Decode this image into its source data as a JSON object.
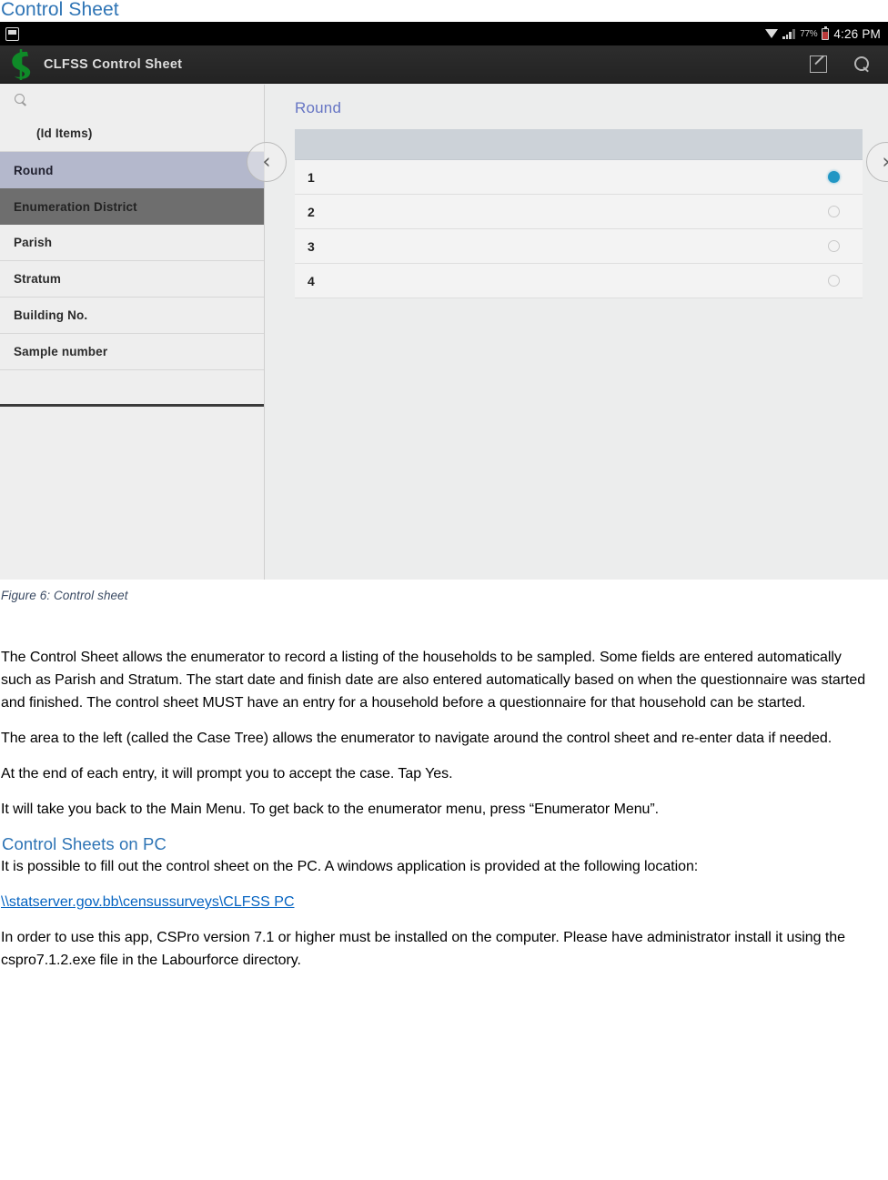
{
  "document": {
    "heading": "Control Sheet",
    "figure_caption": "Figure 6: Control sheet",
    "paragraphs": [
      "The Control Sheet allows the enumerator to record a listing of the households to be sampled. Some fields are entered automatically such as Parish and Stratum. The start date and finish date are also entered automatically based on when the questionnaire was started and finished. The control sheet MUST have an entry for a household before a questionnaire for that household can be started.",
      "The area to the left (called the Case Tree) allows the enumerator to navigate around the control sheet and re-enter data if needed.",
      "At the end of each entry, it will prompt you to accept the case. Tap Yes.",
      "It will take you back to the Main Menu. To get back to the enumerator menu, press “Enumerator Menu”."
    ],
    "subheading": "Control Sheets on PC",
    "pc_intro": "It is possible to fill out the control sheet on the PC. A windows application is provided at the following location:",
    "pc_link": "\\\\statserver.gov.bb\\censussurveys\\CLFSS PC",
    "pc_outro": "In order to use this app, CSPro version 7.1 or higher must be installed on the computer. Please have administrator install it using the cspro7.1.2.exe file in the Labourforce directory.",
    "heading_color": "#2e74b5",
    "link_color": "#0563c1",
    "caption_color": "#3a4a63"
  },
  "screenshot": {
    "status_bar": {
      "sd_icon": "sd-card-icon",
      "wifi_icon": "wifi-icon",
      "signal_icon": "cellular-signal-icon",
      "battery_percent": "77%",
      "battery_icon": "battery-icon",
      "time": "4:26 PM"
    },
    "app_bar": {
      "logo_icon": "clfss-logo-icon",
      "title": "CLFSS Control Sheet",
      "actions": [
        {
          "name": "edit-icon",
          "label": "Edit"
        },
        {
          "name": "search-icon",
          "label": "Search"
        }
      ]
    },
    "case_tree": {
      "search_icon": "search-icon",
      "items": [
        {
          "label": "(Id Items)",
          "state": "group",
          "level": 1
        },
        {
          "label": "Round",
          "state": "selected-light",
          "level": 0
        },
        {
          "label": "Enumeration District",
          "state": "selected-dark",
          "level": 0
        },
        {
          "label": "Parish",
          "state": "normal",
          "level": 0
        },
        {
          "label": "Stratum",
          "state": "normal",
          "level": 0
        },
        {
          "label": "Building No.",
          "state": "normal",
          "level": 0
        },
        {
          "label": "Sample number",
          "state": "last",
          "level": 1
        }
      ]
    },
    "field_panel": {
      "field_label": "Round",
      "options": [
        {
          "label": "1",
          "selected": true
        },
        {
          "label": "2",
          "selected": false
        },
        {
          "label": "3",
          "selected": false
        },
        {
          "label": "4",
          "selected": false
        }
      ],
      "prev_icon": "chevron-left-icon",
      "next_icon": "chevron-right-icon",
      "prev_glyph": "‹",
      "next_glyph": "›",
      "accent_color": "#2196c4",
      "field_label_color": "#6675c4"
    }
  }
}
